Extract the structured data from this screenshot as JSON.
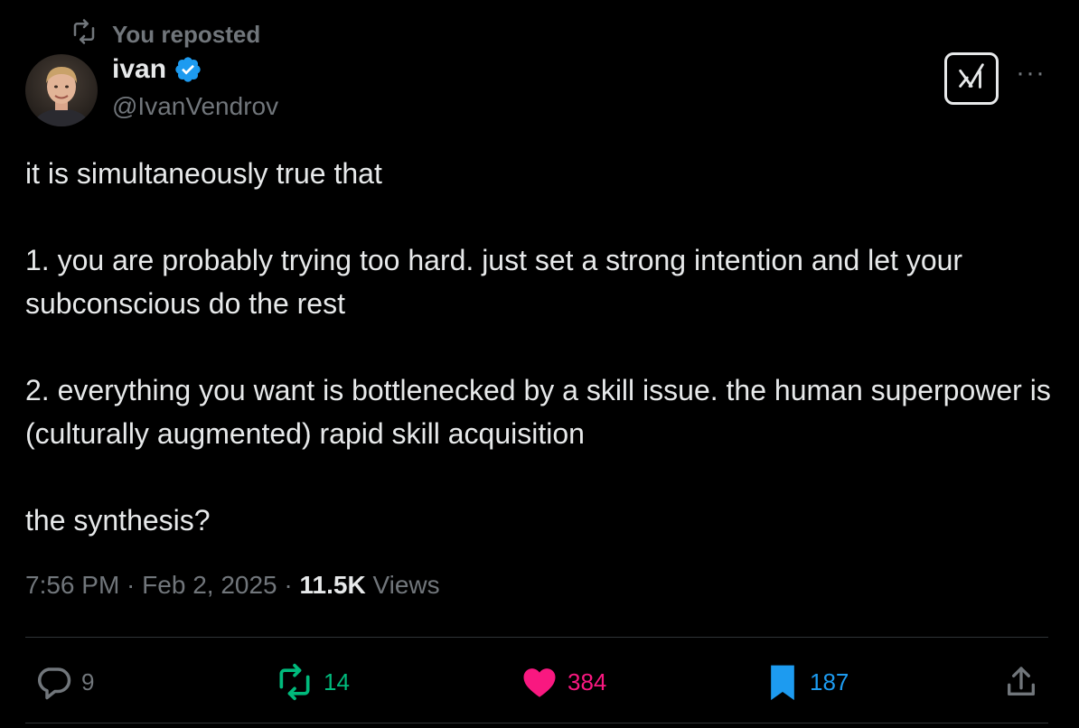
{
  "repost": {
    "label": "You reposted",
    "icon": "repost-icon"
  },
  "author": {
    "name": "ivan",
    "handle": "@IvanVendrov",
    "verified_color": "#1d9bf0"
  },
  "tweet": {
    "paragraphs": [
      "it is simultaneously true that",
      "1. you are probably trying too hard. just set a strong intention and let your subconscious do the rest",
      "2. everything you want is bottlenecked by a skill issue. the human superpower is (culturally augmented) rapid skill acquisition",
      "the synthesis?"
    ]
  },
  "meta": {
    "time": "7:56 PM",
    "sep1": " · ",
    "date": "Feb 2, 2025",
    "sep2": " · ",
    "views_count": "11.5K",
    "views_label": " Views"
  },
  "actions": {
    "reply": {
      "count": "9",
      "icon": "reply-icon",
      "color": "#71767b"
    },
    "repost": {
      "count": "14",
      "icon": "repost-icon",
      "color": "#00ba7c"
    },
    "like": {
      "count": "384",
      "icon": "heart-icon",
      "color": "#f91880"
    },
    "bookmark": {
      "count": "187",
      "icon": "bookmark-icon",
      "color": "#1d9bf0"
    },
    "share": {
      "icon": "share-icon"
    }
  },
  "grok_button": {
    "icon": "grok-icon"
  },
  "more_button": {
    "label": "···",
    "icon": "more-icon"
  }
}
